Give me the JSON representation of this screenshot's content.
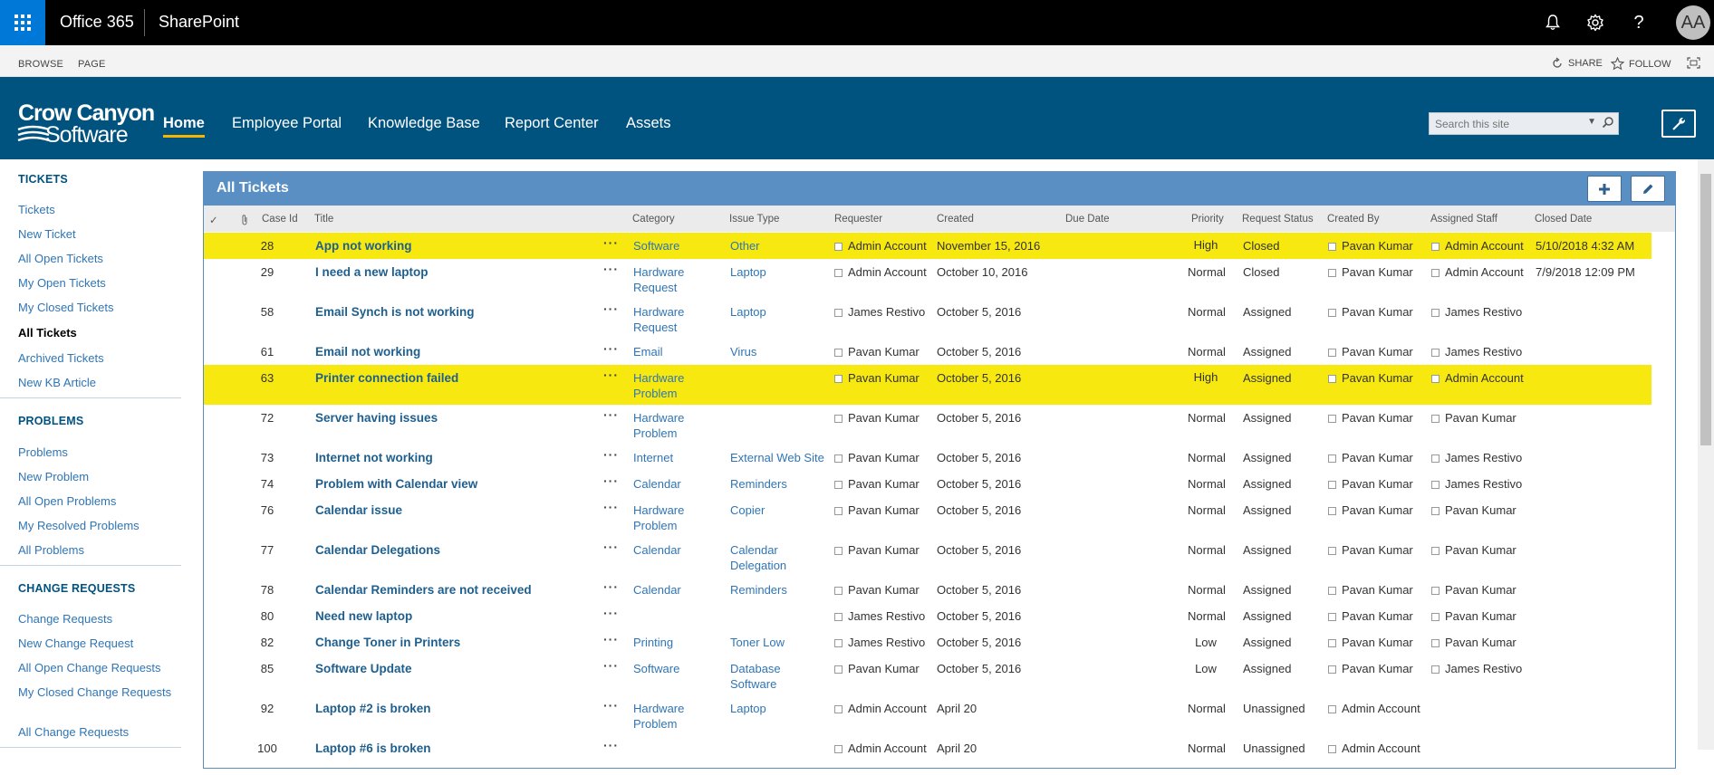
{
  "suite": {
    "brand": "Office 365",
    "app": "SharePoint",
    "avatar_initials": "AA",
    "icons": [
      "waffle-icon",
      "bell-icon",
      "gear-icon",
      "help-icon"
    ]
  },
  "ribbon": {
    "tabs": [
      "BROWSE",
      "PAGE"
    ],
    "share": "SHARE",
    "follow": "FOLLOW"
  },
  "header": {
    "logo_line1": "Crow Canyon",
    "logo_line2": "Software",
    "nav": [
      "Home",
      "Employee Portal",
      "Knowledge Base",
      "Report Center",
      "Assets"
    ],
    "search_placeholder": "Search this site"
  },
  "leftnav": {
    "tickets_heading": "TICKETS",
    "tickets": [
      "Tickets",
      "New Ticket",
      "All Open Tickets",
      "My Open Tickets",
      "My Closed Tickets",
      "All Tickets",
      "Archived Tickets",
      "New KB Article"
    ],
    "problems_heading": "PROBLEMS",
    "problems": [
      "Problems",
      "New Problem",
      "All Open Problems",
      "My Resolved Problems",
      "All Problems"
    ],
    "changes_heading": "CHANGE REQUESTS",
    "changes": [
      "Change Requests",
      "New Change Request",
      "All Open Change Requests",
      "My Closed Change Requests",
      "All Change Requests"
    ]
  },
  "panel": {
    "title": "All Tickets"
  },
  "table": {
    "columns": [
      "✓",
      "Case Id",
      "Title",
      "Category",
      "Issue Type",
      "Requester",
      "Created",
      "Due Date",
      "Priority",
      "Request Status",
      "Created By",
      "Assigned Staff",
      "Closed Date"
    ],
    "rows": [
      {
        "id": "28",
        "title": "App not working",
        "category": "Software",
        "issue": "Other",
        "requester": "Admin Account",
        "created": "November 15, 2016",
        "priority": "High",
        "status": "Closed",
        "created_by": "Pavan Kumar",
        "assigned": "Admin Account",
        "closed": "5/10/2018 4:32 AM",
        "highlight": true
      },
      {
        "id": "29",
        "title": "I need a new laptop",
        "category": "Hardware Request",
        "issue": "Laptop",
        "requester": "Admin Account",
        "created": "October 10, 2016",
        "priority": "Normal",
        "status": "Closed",
        "created_by": "Pavan Kumar",
        "assigned": "Admin Account",
        "closed": "7/9/2018 12:09 PM",
        "highlight": false
      },
      {
        "id": "58",
        "title": "Email Synch is not working",
        "category": "Hardware Request",
        "issue": "Laptop",
        "requester": "James Restivo",
        "created": "October 5, 2016",
        "priority": "Normal",
        "status": "Assigned",
        "created_by": "Pavan Kumar",
        "assigned": "James Restivo",
        "closed": "",
        "highlight": false
      },
      {
        "id": "61",
        "title": "Email not working",
        "category": "Email",
        "issue": "Virus",
        "requester": "Pavan Kumar",
        "created": "October 5, 2016",
        "priority": "Normal",
        "status": "Assigned",
        "created_by": "Pavan Kumar",
        "assigned": "James Restivo",
        "closed": "",
        "highlight": false
      },
      {
        "id": "63",
        "title": "Printer connection failed",
        "category": "Hardware Problem",
        "issue": "",
        "requester": "Pavan Kumar",
        "created": "October 5, 2016",
        "priority": "High",
        "status": "Assigned",
        "created_by": "Pavan Kumar",
        "assigned": "Admin Account",
        "closed": "",
        "highlight": true
      },
      {
        "id": "72",
        "title": "Server having issues",
        "category": "Hardware Problem",
        "issue": "",
        "requester": "Pavan Kumar",
        "created": "October 5, 2016",
        "priority": "Normal",
        "status": "Assigned",
        "created_by": "Pavan Kumar",
        "assigned": "Pavan Kumar",
        "closed": "",
        "highlight": false
      },
      {
        "id": "73",
        "title": "Internet not working",
        "category": "Internet",
        "issue": "External Web Site",
        "requester": "Pavan Kumar",
        "created": "October 5, 2016",
        "priority": "Normal",
        "status": "Assigned",
        "created_by": "Pavan Kumar",
        "assigned": "James Restivo",
        "closed": "",
        "highlight": false
      },
      {
        "id": "74",
        "title": "Problem with Calendar view",
        "category": "Calendar",
        "issue": "Reminders",
        "requester": "Pavan Kumar",
        "created": "October 5, 2016",
        "priority": "Normal",
        "status": "Assigned",
        "created_by": "Pavan Kumar",
        "assigned": "James Restivo",
        "closed": "",
        "highlight": false
      },
      {
        "id": "76",
        "title": "Calendar issue",
        "category": "Hardware Problem",
        "issue": "Copier",
        "requester": "Pavan Kumar",
        "created": "October 5, 2016",
        "priority": "Normal",
        "status": "Assigned",
        "created_by": "Pavan Kumar",
        "assigned": "Pavan Kumar",
        "closed": "",
        "highlight": false
      },
      {
        "id": "77",
        "title": "Calendar Delegations",
        "category": "Calendar",
        "issue": "Calendar Delegation",
        "requester": "Pavan Kumar",
        "created": "October 5, 2016",
        "priority": "Normal",
        "status": "Assigned",
        "created_by": "Pavan Kumar",
        "assigned": "Pavan Kumar",
        "closed": "",
        "highlight": false
      },
      {
        "id": "78",
        "title": "Calendar Reminders are not received",
        "category": "Calendar",
        "issue": "Reminders",
        "requester": "Pavan Kumar",
        "created": "October 5, 2016",
        "priority": "Normal",
        "status": "Assigned",
        "created_by": "Pavan Kumar",
        "assigned": "Pavan Kumar",
        "closed": "",
        "highlight": false
      },
      {
        "id": "80",
        "title": "Need new laptop",
        "category": "",
        "issue": "",
        "requester": "James Restivo",
        "created": "October 5, 2016",
        "priority": "Normal",
        "status": "Assigned",
        "created_by": "Pavan Kumar",
        "assigned": "Pavan Kumar",
        "closed": "",
        "highlight": false
      },
      {
        "id": "82",
        "title": "Change Toner in Printers",
        "category": "Printing",
        "issue": "Toner Low",
        "requester": "James Restivo",
        "created": "October 5, 2016",
        "priority": "Low",
        "status": "Assigned",
        "created_by": "Pavan Kumar",
        "assigned": "Pavan Kumar",
        "closed": "",
        "highlight": false
      },
      {
        "id": "85",
        "title": "Software Update",
        "category": "Software",
        "issue": "Database Software",
        "requester": "Pavan Kumar",
        "created": "October 5, 2016",
        "priority": "Low",
        "status": "Assigned",
        "created_by": "Pavan Kumar",
        "assigned": "James Restivo",
        "closed": "",
        "highlight": false
      },
      {
        "id": "92",
        "title": "Laptop #2 is broken",
        "category": "Hardware Problem",
        "issue": "Laptop",
        "requester": "Admin Account",
        "created": "April 20",
        "priority": "Normal",
        "status": "Unassigned",
        "created_by": "Admin Account",
        "assigned": "",
        "closed": "",
        "highlight": false
      },
      {
        "id": "100",
        "title": "Laptop #6 is broken",
        "category": "",
        "issue": "",
        "requester": "Admin Account",
        "created": "April 20",
        "priority": "Normal",
        "status": "Unassigned",
        "created_by": "Admin Account",
        "assigned": "",
        "closed": "",
        "highlight": false
      }
    ]
  },
  "colors": {
    "suite_bar": "#000000",
    "waffle": "#0078d7",
    "header": "#00527f",
    "panel_title": "#5a8fc3",
    "highlight_row": "#f7e90f",
    "nav_underline": "#f7b500",
    "link": "#2f75b5"
  }
}
